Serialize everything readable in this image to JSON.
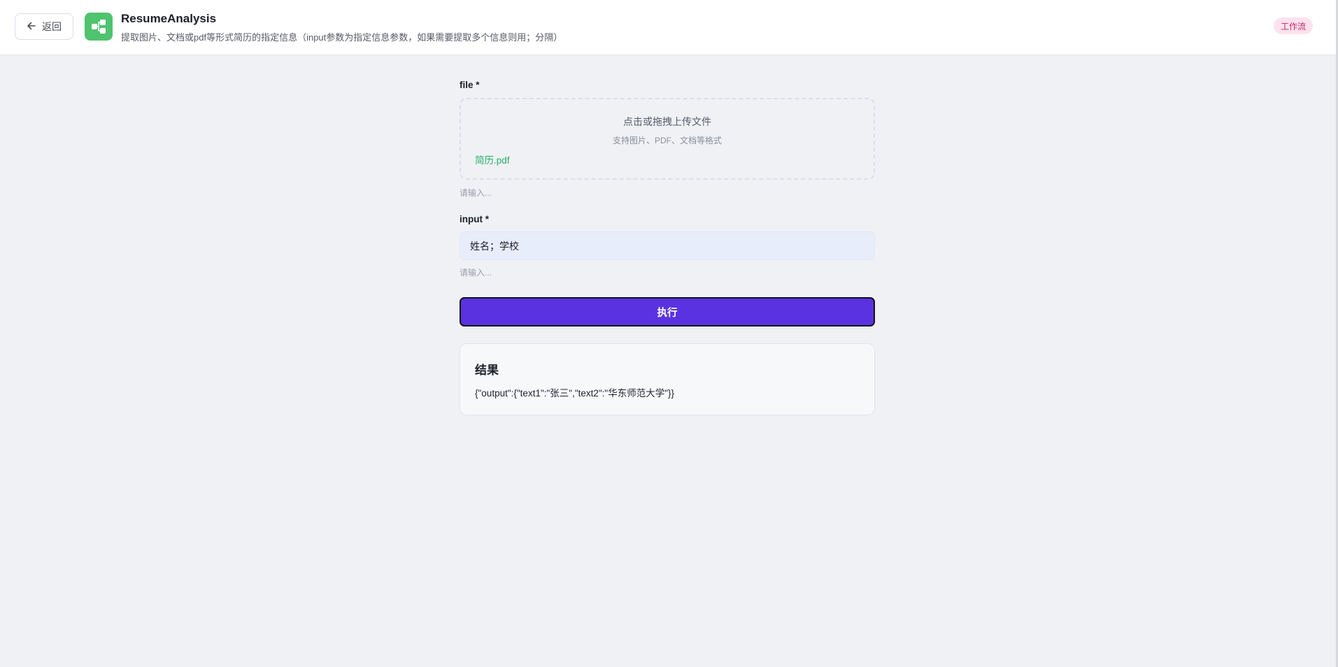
{
  "header": {
    "back_label": "返回",
    "app_title": "ResumeAnalysis",
    "app_description": "提取图片、文档或pdf等形式简历的指定信息（input参数为指定信息参数，如果需要提取多个信息则用；分隔）",
    "type_badge": "工作流",
    "app_icon": "workflow-icon",
    "app_icon_color": "#4fc36e",
    "badge_bg_color": "#fde2ee",
    "badge_text_color": "#c0296a"
  },
  "form": {
    "file_field": {
      "label": "file *",
      "dropzone_title": "点击或拖拽上传文件",
      "dropzone_subtitle": "支持图片、PDF、文档等格式",
      "uploaded_file": "简历.pdf",
      "hint": "请输入..."
    },
    "input_field": {
      "label": "input *",
      "value": "姓名；学校",
      "hint": "请输入..."
    },
    "run_button": {
      "label": "执行",
      "color": "#5b32df"
    }
  },
  "result": {
    "title": "结果",
    "output": "{\"output\":{\"text1\":\"张三\",\"text2\":\"华东师范大学\"}}"
  }
}
